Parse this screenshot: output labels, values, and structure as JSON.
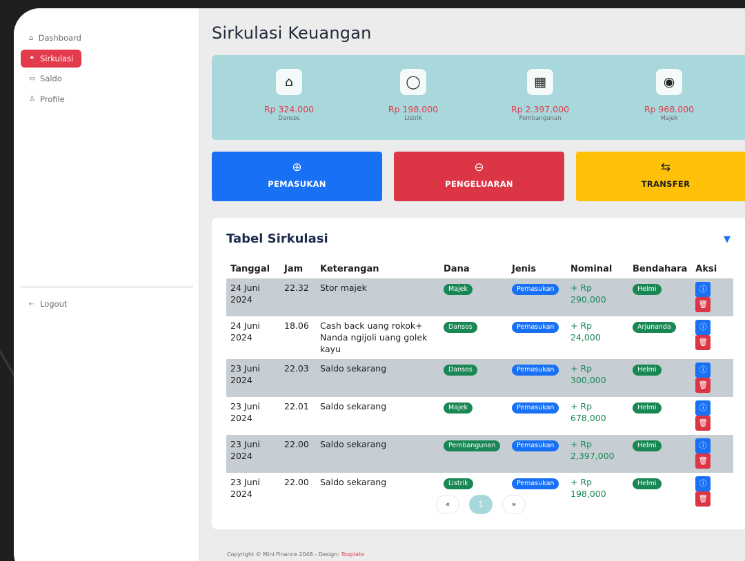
{
  "sidebar": {
    "items": [
      {
        "icon": "home-icon",
        "glyph": "⌂",
        "label": "Dashboard"
      },
      {
        "icon": "tag-icon",
        "glyph": "✦",
        "label": "Sirkulasi"
      },
      {
        "icon": "wallet-icon",
        "glyph": "▭",
        "label": "Saldo"
      },
      {
        "icon": "user-icon",
        "glyph": "♙",
        "label": "Profile"
      }
    ],
    "logout": {
      "icon": "logout-icon",
      "glyph": "⇠",
      "label": "Logout"
    }
  },
  "page": {
    "title": "Sirkulasi Keuangan"
  },
  "stats": [
    {
      "icon": "house-icon",
      "glyph": "⌂",
      "value": "Rp 324.000",
      "label": "Dansos"
    },
    {
      "icon": "lightbulb-icon",
      "glyph": "◯",
      "value": "Rp 198.000",
      "label": "Listrik"
    },
    {
      "icon": "building-icon",
      "glyph": "▦",
      "value": "Rp 2.397.000",
      "label": "Pembangunan"
    },
    {
      "icon": "target-icon",
      "glyph": "◉",
      "value": "Rp 968.000",
      "label": "Majek"
    }
  ],
  "actions": [
    {
      "icon": "plus-circle-icon",
      "glyph": "⊕",
      "label": "PEMASUKAN",
      "color": "#1870f5"
    },
    {
      "icon": "minus-circle-icon",
      "glyph": "⊖",
      "label": "PENGELUARAN",
      "color": "#dc3545"
    },
    {
      "icon": "arrows-exchange-icon",
      "glyph": "⇆",
      "label": "TRANSFER",
      "color": "#ffc107"
    }
  ],
  "table": {
    "title": "Tabel Sirkulasi",
    "headers": [
      "Tanggal",
      "Jam",
      "Keterangan",
      "Dana",
      "Jenis",
      "Nominal",
      "Bendahara",
      "Aksi"
    ],
    "rows": [
      {
        "tanggal": "24 Juni 2024",
        "jam": "22.32",
        "keterangan": "Stor majek",
        "dana": "Majek",
        "jenis": "Pemasukan",
        "nominal": "+ Rp 290,000",
        "bendahara": "Helmi"
      },
      {
        "tanggal": "24 Juni 2024",
        "jam": "18.06",
        "keterangan": "Cash back uang rokok+ Nanda ngijoli uang golek kayu",
        "dana": "Dansos",
        "jenis": "Pemasukan",
        "nominal": "+ Rp 24,000",
        "bendahara": "Arjunanda"
      },
      {
        "tanggal": "23 Juni 2024",
        "jam": "22.03",
        "keterangan": "Saldo sekarang",
        "dana": "Dansos",
        "jenis": "Pemasukan",
        "nominal": "+ Rp 300,000",
        "bendahara": "Helmi"
      },
      {
        "tanggal": "23 Juni 2024",
        "jam": "22.01",
        "keterangan": "Saldo sekarang",
        "dana": "Majek",
        "jenis": "Pemasukan",
        "nominal": "+ Rp 678,000",
        "bendahara": "Helmi"
      },
      {
        "tanggal": "23 Juni 2024",
        "jam": "22.00",
        "keterangan": "Saldo sekarang",
        "dana": "Pembangunan",
        "jenis": "Pemasukan",
        "nominal": "+ Rp 2,397,000",
        "bendahara": "Helmi"
      },
      {
        "tanggal": "23 Juni 2024",
        "jam": "22.00",
        "keterangan": "Saldo sekarang",
        "dana": "Listrik",
        "jenis": "Pemasukan",
        "nominal": "+ Rp 198,000",
        "bendahara": "Helmi"
      }
    ]
  },
  "pagination": {
    "prev": "«",
    "current": "1",
    "next": "»"
  },
  "footer": {
    "text": "Copyright © Mini Finance 2048 - Design: ",
    "brand": "Tooplate"
  }
}
